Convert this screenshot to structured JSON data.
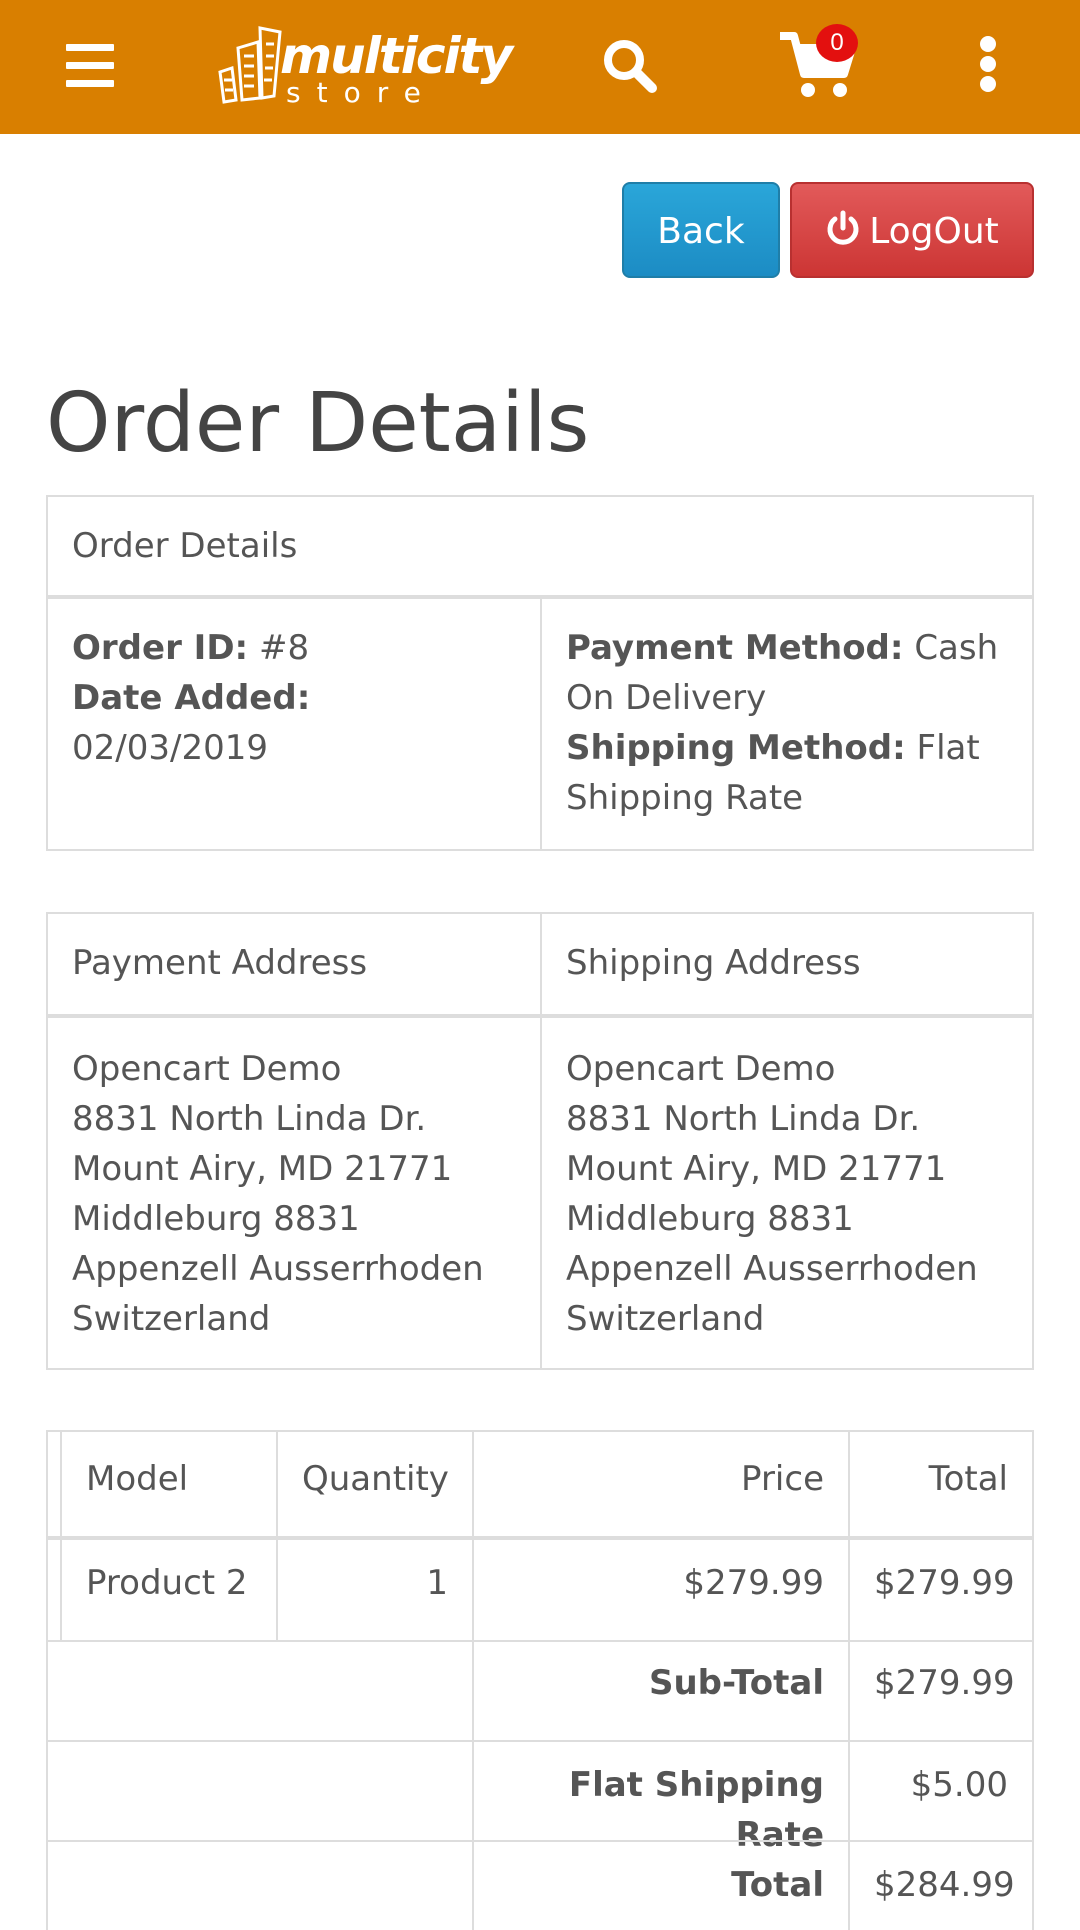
{
  "header": {
    "logo_main": "multicity",
    "logo_sub": "store",
    "cart_count": "0",
    "icons": [
      "menu-icon",
      "search-icon",
      "cart-icon",
      "more-vertical-icon"
    ],
    "colors": {
      "bar": "#d97f00",
      "badge": "#e3100f"
    }
  },
  "actions": {
    "back_label": "Back",
    "logout_label": "LogOut",
    "colors": {
      "back": "#1c8cc4",
      "logout": "#cc3534"
    }
  },
  "page_title": "Order Details",
  "order_box": {
    "heading": "Order Details",
    "order_id_label": "Order ID:",
    "order_id": "#8",
    "date_label": "Date Added:",
    "date": "02/03/2019",
    "payment_method_label": "Payment Method:",
    "payment_method": "Cash On Delivery",
    "shipping_method_label": "Shipping Method:",
    "shipping_method": "Flat Shipping Rate"
  },
  "address_box": {
    "payment_heading": "Payment Address",
    "shipping_heading": "Shipping Address",
    "payment_lines": [
      "Opencart Demo",
      "8831 North Linda Dr.",
      "Mount Airy, MD 21771",
      "Middleburg 8831",
      "Appenzell Ausserrhoden",
      "Switzerland"
    ],
    "shipping_lines": [
      "Opencart Demo",
      "8831 North Linda Dr.",
      "Mount Airy, MD 21771",
      "Middleburg 8831",
      "Appenzell Ausserrhoden",
      "Switzerland"
    ]
  },
  "products": {
    "columns": [
      "Model",
      "Quantity",
      "Price",
      "Total"
    ],
    "rows": [
      {
        "model": "Product 2",
        "quantity": "1",
        "price": "$279.99",
        "total": "$279.99"
      }
    ],
    "totals": [
      {
        "label": "Sub-Total",
        "value": "$279.99"
      },
      {
        "label": "Flat Shipping Rate",
        "value": "$5.00"
      },
      {
        "label": "Total",
        "value": "$284.99"
      }
    ]
  }
}
